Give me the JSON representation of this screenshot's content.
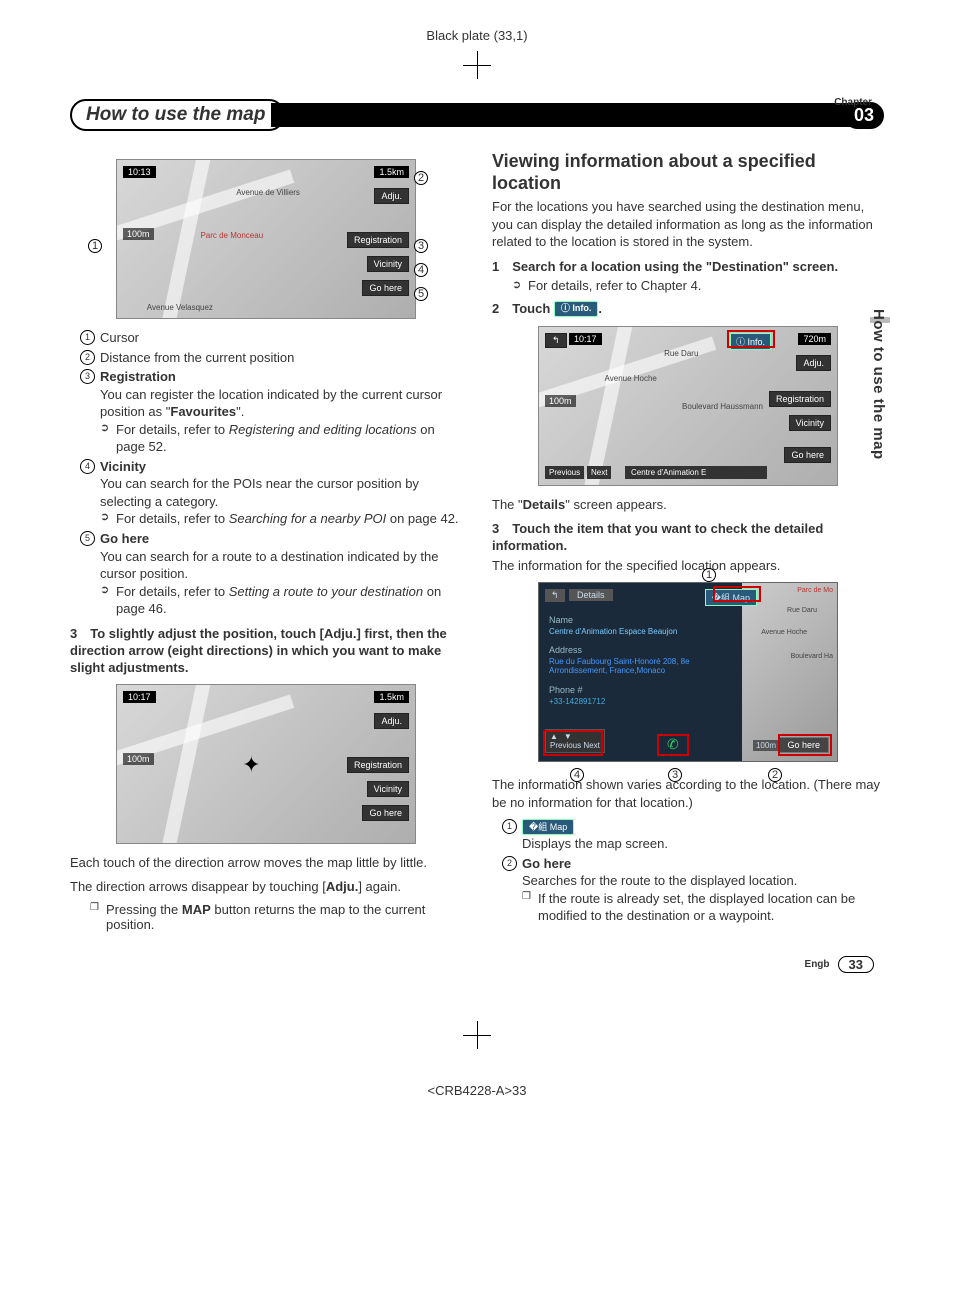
{
  "plate": "Black plate (33,1)",
  "chapterLabel": "Chapter",
  "chapterNum": "03",
  "title": "How to use the map",
  "sideTab": "How to use the map",
  "fig1": {
    "clock": "10:13",
    "dist": "1.5km",
    "scale": "100m",
    "adju": "Adju.",
    "reg": "Registration",
    "vic": "Vicinity",
    "go": "Go here",
    "street1": "Avenue de Villiers",
    "street2": "Avenue Velasquez",
    "park": "Parc de Monceau"
  },
  "list1": {
    "i1": "Cursor",
    "i2": "Distance from the current position",
    "i3t": "Registration",
    "i3a": "You can register the location indicated by the current cursor position as \"",
    "i3b": "Favourites",
    "i3c": "\".",
    "i3d": "For details, refer to ",
    "i3e": "Registering and editing locations",
    "i3f": " on page 52.",
    "i4t": "Vicinity",
    "i4a": "You can search for the POIs near the cursor position by selecting a category.",
    "i4b": "For details, refer to ",
    "i4c": "Searching for a nearby POI",
    "i4d": " on page 42.",
    "i5t": "Go here",
    "i5a": "You can search for a route to a destination indicated by the cursor position.",
    "i5b": "For details, refer to ",
    "i5c": "Setting a route to your destination",
    "i5d": " on page 46."
  },
  "step3": "3 To slightly adjust the position, touch [Adju.] first, then the direction arrow (eight directions) in which you want to make slight adjustments.",
  "fig2": {
    "clock": "10:17",
    "dist": "1.5km",
    "scale": "100m",
    "adju": "Adju.",
    "reg": "Registration",
    "vic": "Vicinity",
    "go": "Go here"
  },
  "para1": "Each touch of the direction arrow moves the map little by little.",
  "para2a": "The direction arrows disappear by touching [",
  "para2b": "Adju.",
  "para2c": "] again.",
  "para3a": "Pressing the ",
  "para3b": "MAP",
  "para3c": " button returns the map to the current position.",
  "h2": "Viewing information about a specified location",
  "rpara1": "For the locations you have searched using the destination menu, you can display the detailed information as long as the information related to the location is stored in the system.",
  "rstep1": "1 Search for a location using the \"Destination\" screen.",
  "rstep1a": "For details, refer to Chapter 4.",
  "rstep2a": "2 Touch ",
  "infoBtn": "ⓘ Info.",
  "rstep2b": ".",
  "fig3": {
    "clock": "10:17",
    "dist": "720m",
    "scale": "100m",
    "adju": "Adju.",
    "reg": "Registration",
    "vic": "Vicinity",
    "go": "Go here",
    "poi": "Centre d'Animation E",
    "prev": "Previous",
    "next": "Next",
    "info": "ⓘ Info.",
    "back": "↰",
    "street1": "Avenue Hoche",
    "street2": "Boulevard Haussmann",
    "street3": "Rue Daru"
  },
  "rpara2a": "The \"",
  "rpara2b": "Details",
  "rpara2c": "\" screen appears.",
  "rstep3": "3 Touch the item that you want to check the detailed information.",
  "rpara3": "The information for the specified location appears.",
  "det": {
    "back": "↰",
    "title": "Details",
    "map": "�組 Map",
    "nameL": "Name",
    "nameV": "Centre d'Animation Espace Beaujon",
    "addrL": "Address",
    "addrV": "Rue du Faubourg Saint-Honoré 208, 8e Arrondissement, France,Monaco",
    "phoneL": "Phone #",
    "phoneV": "+33-142891712",
    "prev": "Previous",
    "next": "Next",
    "go": "Go here",
    "scale": "100m",
    "m1": "Parc de Mo",
    "m2": "Boulevard Ha",
    "m3": "Rue Daru",
    "m4": "Avenue Hoche"
  },
  "rpara4": "The information shown varies according to the location. (There may be no information for that location.)",
  "mapBtn": "�組 Map",
  "list2": {
    "i1": "Displays the map screen.",
    "i2t": "Go here",
    "i2a": "Searches for the route to the displayed location.",
    "i2b": "If the route is already set, the displayed location can be modified to the destination or a waypoint."
  },
  "lang": "Engb",
  "pageNum": "33",
  "docId": "<CRB4228-A>33"
}
